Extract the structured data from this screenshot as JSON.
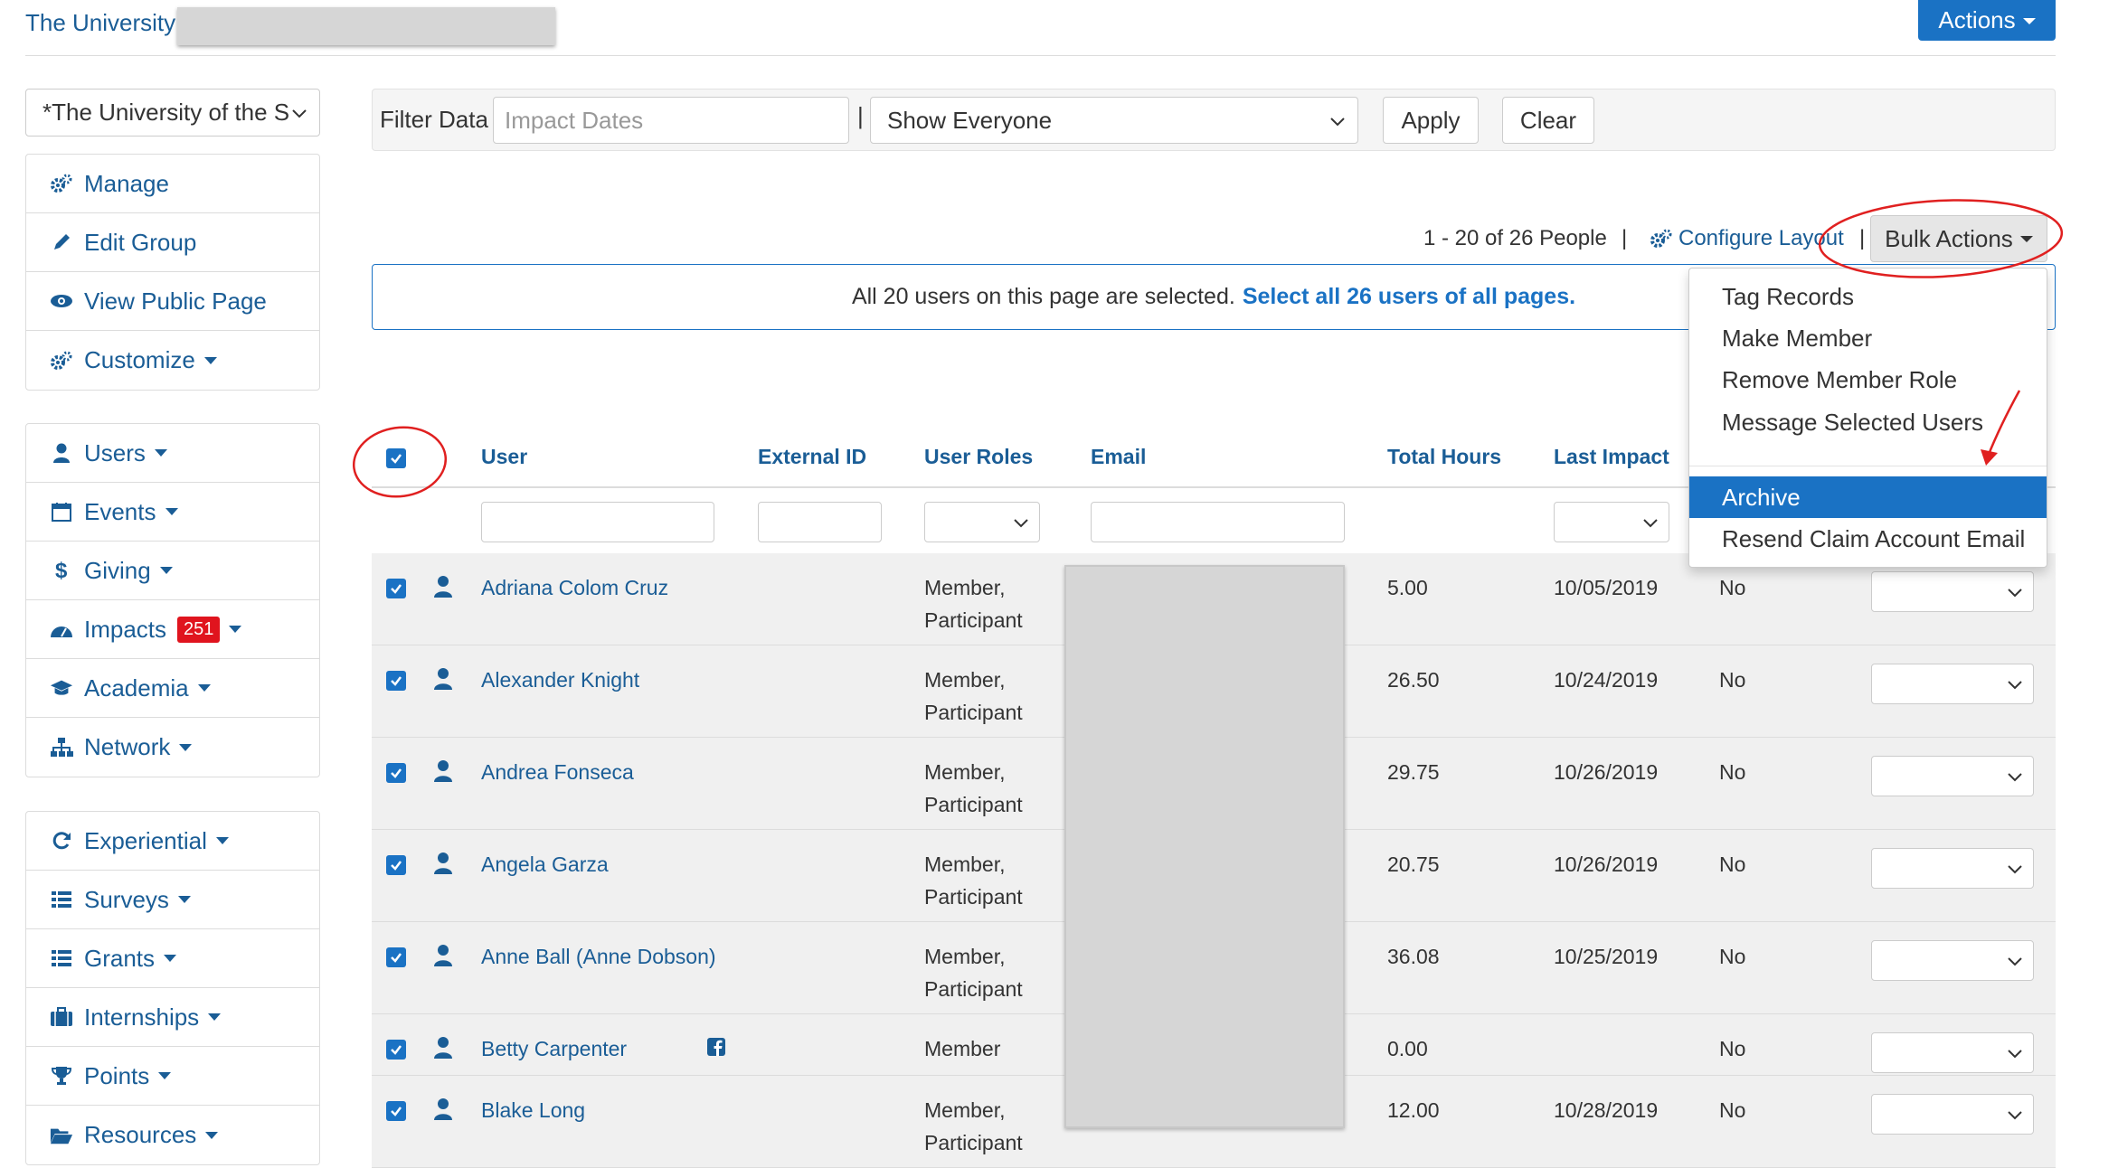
{
  "header": {
    "org_name": "The University",
    "actions_label": "Actions"
  },
  "sidebar": {
    "org_select_value": "*The University of the S",
    "groups": [
      [
        {
          "label": "Manage",
          "icon": "gears-icon",
          "caret": false
        },
        {
          "label": "Edit Group",
          "icon": "pencil-icon",
          "caret": false
        },
        {
          "label": "View Public Page",
          "icon": "eye-icon",
          "caret": false
        },
        {
          "label": "Customize",
          "icon": "gears-icon",
          "caret": true
        }
      ],
      [
        {
          "label": "Users",
          "icon": "user-icon",
          "caret": true
        },
        {
          "label": "Events",
          "icon": "calendar-icon",
          "caret": true
        },
        {
          "label": "Giving",
          "icon": "dollar-icon",
          "caret": true
        },
        {
          "label": "Impacts",
          "icon": "dashboard-icon",
          "caret": true,
          "badge": "251"
        },
        {
          "label": "Academia",
          "icon": "graduation-cap-icon",
          "caret": true
        },
        {
          "label": "Network",
          "icon": "sitemap-icon",
          "caret": true
        }
      ],
      [
        {
          "label": "Experiential",
          "icon": "refresh-icon",
          "caret": true
        },
        {
          "label": "Surveys",
          "icon": "list-icon",
          "caret": true
        },
        {
          "label": "Grants",
          "icon": "list-icon",
          "caret": true
        },
        {
          "label": "Internships",
          "icon": "briefcase-icon",
          "caret": true
        },
        {
          "label": "Points",
          "icon": "trophy-icon",
          "caret": true
        },
        {
          "label": "Resources",
          "icon": "folder-open-icon",
          "caret": true
        }
      ]
    ]
  },
  "filter": {
    "label": "Filter Data",
    "date_placeholder": "Impact Dates",
    "separator": "|",
    "select_value": "Show Everyone",
    "apply_label": "Apply",
    "clear_label": "Clear"
  },
  "toolbar": {
    "page_info": "1 - 20 of 26 People",
    "pipe": "|",
    "configure_label": "Configure Layout",
    "bulk_label": "Bulk Actions"
  },
  "notice": {
    "text": "All 20 users on this page are selected.",
    "link": "Select all 26 users of all pages."
  },
  "table": {
    "headers": {
      "user": "User",
      "external_id": "External ID",
      "user_roles": "User Roles",
      "email": "Email",
      "total_hours": "Total Hours",
      "last_impact": "Last Impact"
    },
    "rows": [
      {
        "name": "Adriana Colom Cruz",
        "roles1": "Member,",
        "roles2": "Participant",
        "hours": "5.00",
        "last": "10/05/2019",
        "flag": "No",
        "fb": false
      },
      {
        "name": "Alexander Knight",
        "roles1": "Member,",
        "roles2": "Participant",
        "hours": "26.50",
        "last": "10/24/2019",
        "flag": "No",
        "fb": false
      },
      {
        "name": "Andrea Fonseca",
        "roles1": "Member,",
        "roles2": "Participant",
        "hours": "29.75",
        "last": "10/26/2019",
        "flag": "No",
        "fb": false
      },
      {
        "name": "Angela Garza",
        "roles1": "Member,",
        "roles2": "Participant",
        "hours": "20.75",
        "last": "10/26/2019",
        "flag": "No",
        "fb": false
      },
      {
        "name": "Anne Ball (Anne Dobson)",
        "roles1": "Member,",
        "roles2": "Participant",
        "hours": "36.08",
        "last": "10/25/2019",
        "flag": "No",
        "fb": false
      },
      {
        "name": "Betty Carpenter",
        "roles1": "Member",
        "roles2": "",
        "hours": "0.00",
        "last": "",
        "flag": "No",
        "fb": true
      },
      {
        "name": "Blake Long",
        "roles1": "Member,",
        "roles2": "Participant",
        "hours": "12.00",
        "last": "10/28/2019",
        "flag": "No",
        "fb": false
      }
    ]
  },
  "bulk_menu": {
    "items": [
      "Tag Records",
      "Make Member",
      "Remove Member Role",
      "Message Selected Users",
      "Archive",
      "Resend Claim Account Email"
    ],
    "active": "Archive"
  },
  "colors": {
    "primary": "#1a72c4",
    "link": "#1a5d96",
    "badge": "#e0141e",
    "annotation": "#e02020",
    "row_bg": "#f0f0f0"
  }
}
